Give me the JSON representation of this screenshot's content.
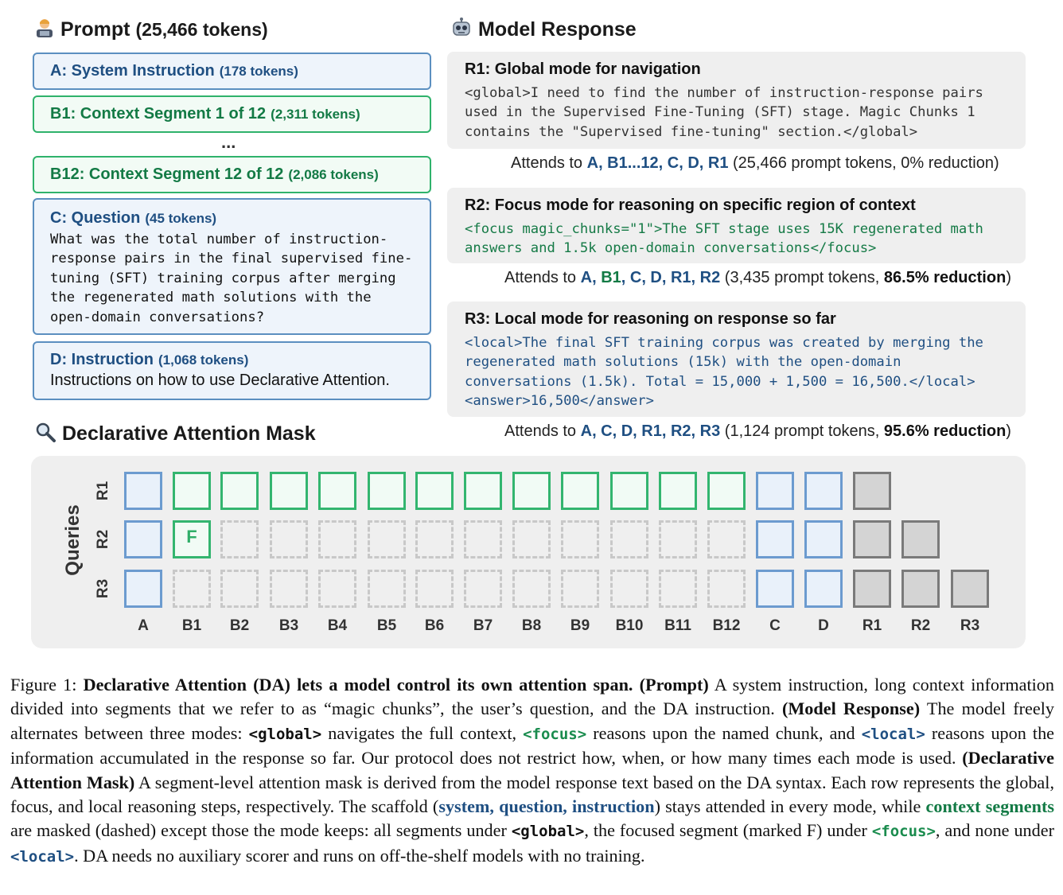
{
  "prompt": {
    "title": "Prompt",
    "tokens": "(25,466 tokens)",
    "boxes": {
      "a": {
        "title": "A: System Instruction",
        "tokens": "(178 tokens)"
      },
      "b1": {
        "title": "B1: Context Segment 1 of 12",
        "tokens": "(2,311 tokens)"
      },
      "ellipsis": "...",
      "b12": {
        "title": "B12: Context Segment 12 of 12",
        "tokens": "(2,086 tokens)"
      },
      "c": {
        "title": "C: Question",
        "tokens": "(45 tokens)",
        "text": "What was the total number of instruction-\nresponse pairs in the final supervised fine-\ntuning (SFT) training corpus after merging\nthe regenerated math solutions with the\nopen-domain conversations?"
      },
      "d": {
        "title": "D: Instruction",
        "tokens": "(1,068 tokens)",
        "text": "Instructions on how to  use Declarative Attention."
      }
    }
  },
  "response": {
    "title": "Model Response",
    "r1": {
      "title": "R1: Global mode for navigation",
      "code": "<global>I need to find the number of instruction-response pairs\nused in the Supervised Fine-Tuning (SFT) stage. Magic Chunks 1\ncontains the \"Supervised fine-tuning\" section.</global>",
      "attends_prefix": "Attends to ",
      "attends_sets": "A, B1...12, C, D, R1",
      "attends_suffix": " (25,466 prompt tokens, 0% reduction)"
    },
    "r2": {
      "title": "R2: Focus mode for reasoning on specific region of context",
      "code": "<focus magic_chunks=\"1\">The SFT stage uses 15K regenerated math\nanswers and 1.5k open-domain conversations</focus>",
      "attends_prefix": "Attends to ",
      "attends_a": "A, ",
      "attends_b1": "B1",
      "attends_rest": ", C, D, R1, R2",
      "attends_mid": " (3,435 prompt tokens, ",
      "attends_red": "86.5% reduction",
      "attends_end": ")"
    },
    "r3": {
      "title": "R3: Local mode for reasoning on response so far",
      "code": "<local>The final SFT training corpus was created by merging the\nregenerated math solutions (15k) with the open-domain\nconversations (1.5k). Total = 15,000 + 1,500 = 16,500.</local>\n<answer>16,500</answer>",
      "attends_prefix": "Attends to ",
      "attends_sets": "A, C, D, R1, R2, R3",
      "attends_mid": " (1,124 prompt tokens, ",
      "attends_red": "95.6% reduction",
      "attends_end": ")"
    }
  },
  "mask": {
    "title": "Declarative Attention Mask",
    "y_label": "Queries",
    "rows": [
      "R1",
      "R2",
      "R3"
    ],
    "columns": [
      "A",
      "B1",
      "B2",
      "B3",
      "B4",
      "B5",
      "B6",
      "B7",
      "B8",
      "B9",
      "B10",
      "B11",
      "B12",
      "C",
      "D",
      "R1",
      "R2",
      "R3"
    ],
    "focus_marker": "F",
    "cells": [
      [
        "blue",
        "green",
        "green",
        "green",
        "green",
        "green",
        "green",
        "green",
        "green",
        "green",
        "green",
        "green",
        "green",
        "blue",
        "blue",
        "gray",
        "none",
        "none"
      ],
      [
        "blue",
        "focus",
        "dash",
        "dash",
        "dash",
        "dash",
        "dash",
        "dash",
        "dash",
        "dash",
        "dash",
        "dash",
        "dash",
        "blue",
        "blue",
        "gray",
        "gray",
        "none"
      ],
      [
        "blue",
        "dash",
        "dash",
        "dash",
        "dash",
        "dash",
        "dash",
        "dash",
        "dash",
        "dash",
        "dash",
        "dash",
        "dash",
        "blue",
        "blue",
        "gray",
        "gray",
        "gray"
      ]
    ],
    "colors": {
      "scaffold": "#6c9bcf",
      "context": "#33b56f",
      "response": "#7a7a7a"
    }
  },
  "caption": {
    "p1": "Figure 1: ",
    "p2": "Declarative Attention (DA) lets a model control its own attention span. (Prompt)",
    "p3": " A system instruction, long context information divided into segments that we refer to as “magic chunks”, the user’s question, and the DA instruction. ",
    "p4": "(Model Response)",
    "p5": " The model freely alternates between three modes: ",
    "t_global": "<global>",
    "p6": " navigates the full context, ",
    "t_focus": "<focus>",
    "p7": " reasons upon the named chunk, and ",
    "t_local": "<local>",
    "p8": " reasons upon the information accumulated in the response so far. Our protocol does not restrict how, when, or how many times each mode is used. ",
    "p9": "(Declarative Attention Mask)",
    "p10": " A segment-level attention mask is derived from the model response text based on the DA syntax. Each row represents the global, focus, and local reasoning steps, respectively. The scaffold (",
    "p11": "system, question, instruction",
    "p12": ") stays attended in every mode, while ",
    "p13": "context segments",
    "p14": " are masked (dashed) except those the mode keeps: all segments under ",
    "t_global2": "<global>",
    "p15": ", the focused segment (marked F) under ",
    "t_focus2": "<focus>",
    "p16": ", and none under ",
    "t_local2": "<local>",
    "p17": ". DA needs no auxiliary scorer and runs on off-the-shelf models with no training."
  }
}
